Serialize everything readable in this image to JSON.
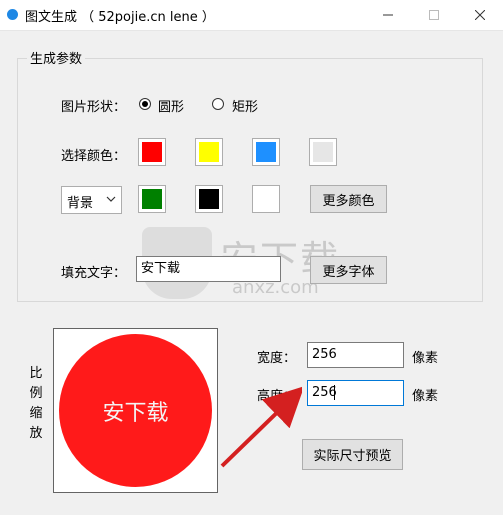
{
  "window": {
    "title": "图文生成 （ 52pojie.cn lene ）",
    "accent": "#1e88e5"
  },
  "group": {
    "title": "生成参数"
  },
  "shape": {
    "label": "图片形状：",
    "options": [
      {
        "label": "圆形",
        "checked": true
      },
      {
        "label": "矩形",
        "checked": false
      }
    ]
  },
  "color": {
    "label": "选择颜色：",
    "swatches_row1": [
      "#ff0000",
      "#ffff00",
      "#1e90ff",
      "#e6e6e6"
    ],
    "swatches_row2": [
      "#008000",
      "#000000",
      "#ffffff"
    ],
    "more_button": "更多颜色"
  },
  "target": {
    "selected": "背景"
  },
  "fill_text": {
    "label": "填充文字：",
    "value": "安下载",
    "font_button": "更多字体"
  },
  "scale": {
    "label_chars": [
      "比",
      "例",
      "缩",
      "放"
    ]
  },
  "preview": {
    "text": "安下载",
    "fill": "#ff1a1a"
  },
  "size": {
    "width_label": "宽度：",
    "width_value": "256",
    "height_label": "高度：",
    "height_value": "256",
    "unit": "像素",
    "preview_button": "实际尺寸预览"
  },
  "watermark": {
    "cn": "安下载",
    "en": "anxz.com"
  }
}
